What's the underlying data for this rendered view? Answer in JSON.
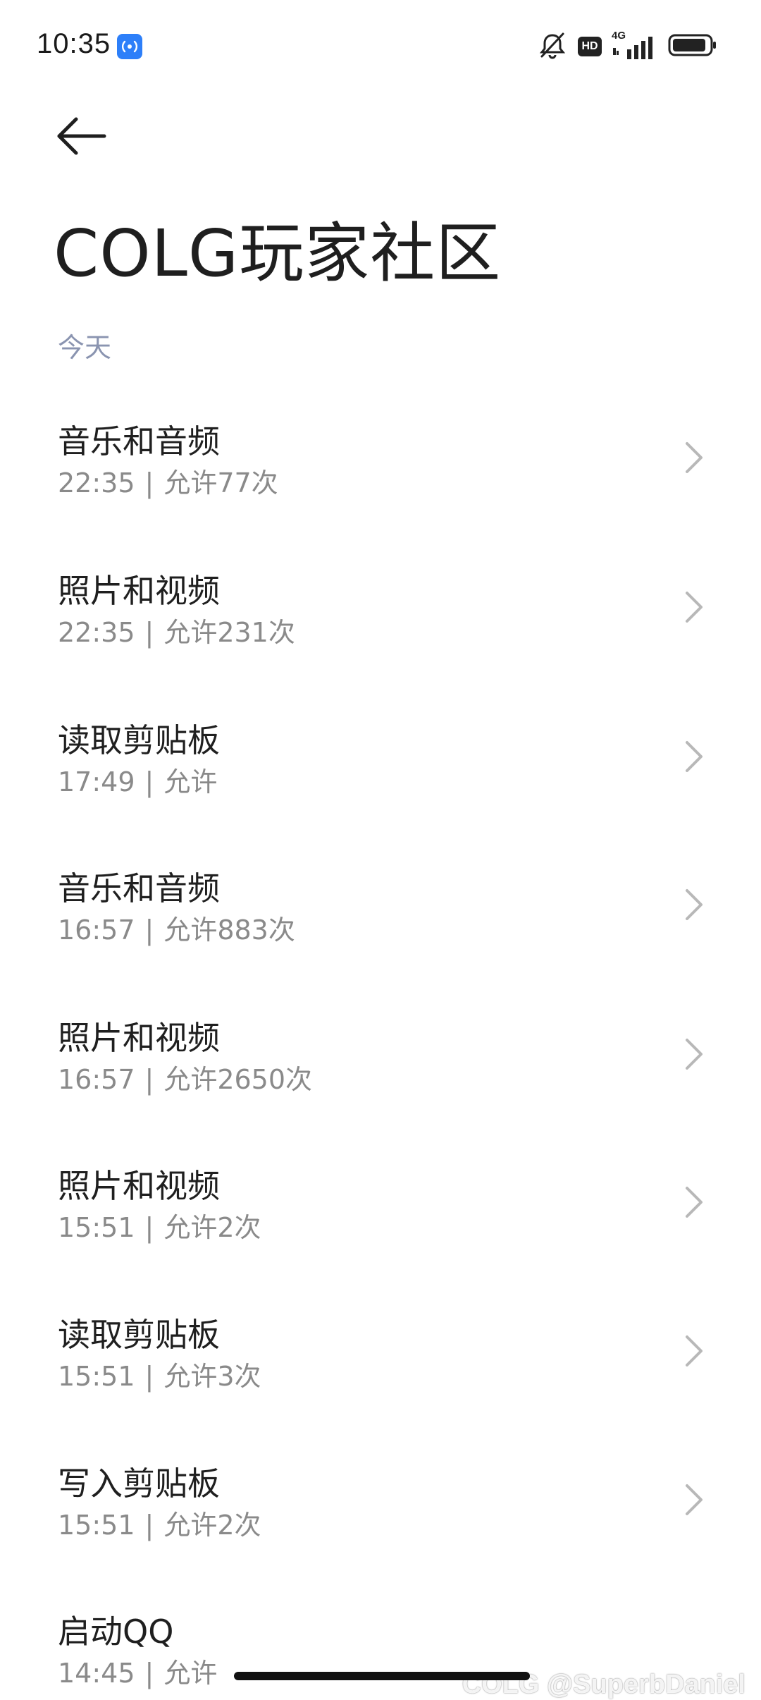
{
  "status_bar": {
    "time": "10:35",
    "cast_icon": "screen-cast-icon",
    "icons": [
      "mute-bell-icon",
      "hd-badge",
      "4g-signal-icon",
      "battery-icon"
    ],
    "hd_label": "HD",
    "network_label": "4G"
  },
  "header": {
    "back_icon": "arrow-left-icon",
    "title": "COLG玩家社区"
  },
  "section": {
    "label": "今天"
  },
  "records": [
    {
      "title": "音乐和音频",
      "time": "22:35",
      "status": "允许77次"
    },
    {
      "title": "照片和视频",
      "time": "22:35",
      "status": "允许231次"
    },
    {
      "title": "读取剪贴板",
      "time": "17:49",
      "status": "允许"
    },
    {
      "title": "音乐和音频",
      "time": "16:57",
      "status": "允许883次"
    },
    {
      "title": "照片和视频",
      "time": "16:57",
      "status": "允许2650次"
    },
    {
      "title": "照片和视频",
      "time": "15:51",
      "status": "允许2次"
    },
    {
      "title": "读取剪贴板",
      "time": "15:51",
      "status": "允许3次"
    },
    {
      "title": "写入剪贴板",
      "time": "15:51",
      "status": "允许2次"
    },
    {
      "title": "启动QQ",
      "time": "14:45",
      "status": "允许"
    }
  ],
  "separator": "|",
  "watermark": "COLG @SuperbDaniel"
}
